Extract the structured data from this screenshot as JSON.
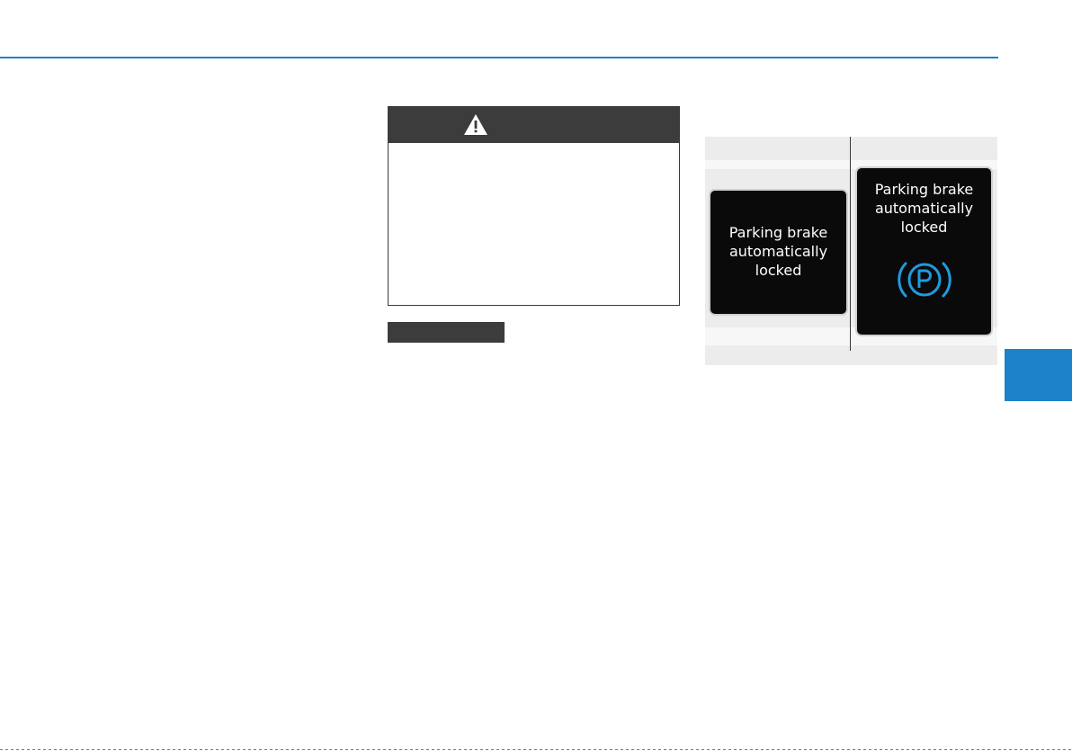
{
  "warning": {
    "icon": "warning-triangle-icon",
    "header_color": "#3c3c3c"
  },
  "figure": {
    "left_screen_text": "Parking brake\nautomatically\nlocked",
    "right_screen_text": "Parking brake\nautomatically\nlocked",
    "right_icon": "parking-brake-icon"
  },
  "colors": {
    "accent": "#1e82c8",
    "indicator": "#1e9be0"
  }
}
